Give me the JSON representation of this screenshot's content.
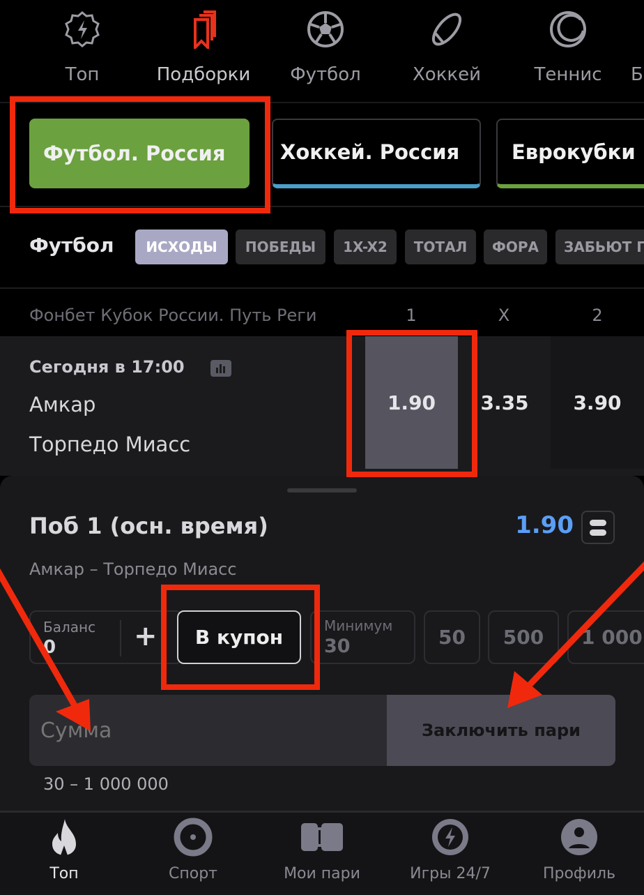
{
  "top_nav": {
    "items": [
      {
        "label": "Топ",
        "icon": "lightning-badge-icon"
      },
      {
        "label": "Подборки",
        "icon": "bookmarks-icon",
        "active": true
      },
      {
        "label": "Футбол",
        "icon": "soccer-ball-icon"
      },
      {
        "label": "Хоккей",
        "icon": "hockey-puck-icon"
      },
      {
        "label": "Теннис",
        "icon": "tennis-ball-icon"
      },
      {
        "label": "Б"
      }
    ]
  },
  "collections": [
    {
      "label": "Футбол. Россия",
      "color": "#6ba13f",
      "active": true
    },
    {
      "label": "Хоккей. Россия",
      "color": "#4a9ec8"
    },
    {
      "label": "Еврокубки",
      "color": "#6ba13f"
    }
  ],
  "filters": {
    "sport": "Футбол",
    "chips": [
      "ИСХОДЫ",
      "ПОБЕДЫ",
      "1X-X2",
      "ТОТАЛ",
      "ФОРА",
      "ЗАБЬЮТ Г"
    ],
    "active": "ИСХОДЫ"
  },
  "tournament": {
    "name": "Фонбет Кубок России. Путь Реги",
    "columns": [
      "1",
      "X",
      "2"
    ]
  },
  "match": {
    "time": "Сегодня в 17:00",
    "team1": "Амкар",
    "team2": "Торпедо Миасс",
    "odds": [
      "1.90",
      "3.35",
      "3.90"
    ],
    "selected": "1.90"
  },
  "bet_slip": {
    "title": "Поб 1 (осн. время)",
    "odd": "1.90",
    "match": "Амкар – Торпедо Миасс",
    "balance_label": "Баланс",
    "balance_value": "0",
    "plus": "+",
    "coupon_button": "В купон",
    "min_label": "Минимум",
    "min_value": "30",
    "quick_amounts": [
      "50",
      "500",
      "1 000"
    ],
    "amount_placeholder": "Сумма",
    "submit": "Заключить пари",
    "range": "30 – 1 000 000",
    "accent": "#5b9ef5"
  },
  "bottom_nav": {
    "items": [
      {
        "label": "Топ",
        "icon": "flame-icon",
        "active": true
      },
      {
        "label": "Спорт",
        "icon": "sport-disc-icon"
      },
      {
        "label": "Мои пари",
        "icon": "ticket-icon"
      },
      {
        "label": "Игры 24/7",
        "icon": "lightning-circle-icon"
      },
      {
        "label": "Профиль",
        "icon": "profile-icon"
      }
    ]
  },
  "annotation_color": "#f0290d"
}
